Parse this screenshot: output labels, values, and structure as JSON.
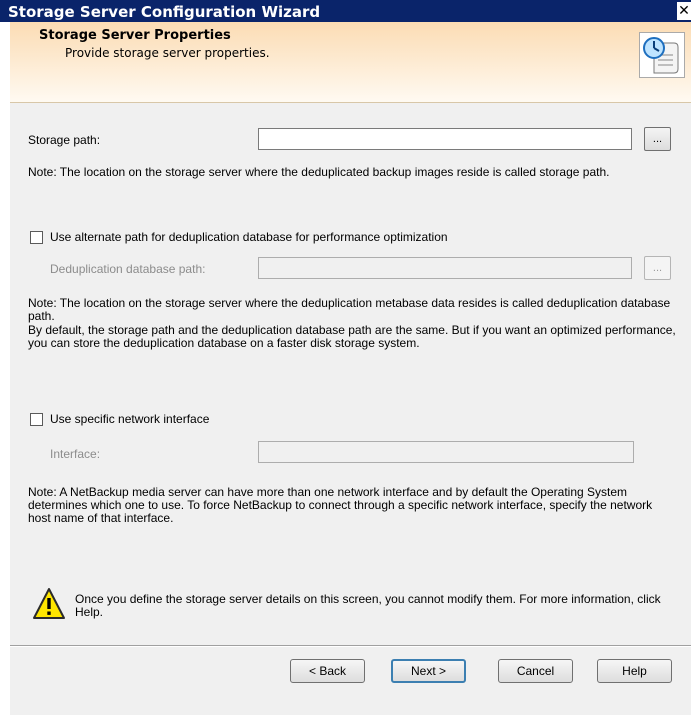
{
  "window": {
    "title": "Storage Server Configuration Wizard",
    "close_glyph": "✕"
  },
  "header": {
    "title": "Storage Server Properties",
    "subtitle": "Provide storage server properties.",
    "icon": "wizard-clock-scroll-icon"
  },
  "storage": {
    "label": "Storage path:",
    "value": "",
    "browse_label": "...",
    "note": "Note: The location on the storage server where the deduplicated backup images reside is called storage path."
  },
  "dedup": {
    "checkbox_label": "Use alternate path for deduplication database for performance optimization",
    "checked": false,
    "path_label": "Deduplication database path:",
    "value": "",
    "browse_label": "...",
    "note1": "Note: The location on the storage server where the deduplication metabase data resides is called deduplication database path.",
    "note2": "By default, the storage path and the deduplication database path are the same. But if you want an optimized performance, you can store the deduplication database on a faster disk storage system."
  },
  "network": {
    "checkbox_label": "Use specific network interface",
    "checked": false,
    "interface_label": "Interface:",
    "value": "",
    "note": "Note: A NetBackup media server can have more than one network interface and by default the Operating System determines which one to use. To force NetBackup to connect through a specific network interface, specify the network host name of that interface."
  },
  "warning": {
    "icon": "warning-icon",
    "color": "#ffe600",
    "text": "Once you define the storage server details on this screen, you cannot modify them. For more information, click Help."
  },
  "buttons": {
    "back": "< Back",
    "next": "Next >",
    "cancel": "Cancel",
    "help": "Help"
  }
}
